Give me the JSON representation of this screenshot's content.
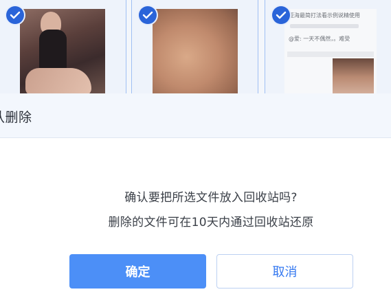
{
  "files": [
    {
      "selected": true,
      "kind": "photo"
    },
    {
      "selected": true,
      "kind": "photo"
    },
    {
      "selected": true,
      "kind": "screenshot",
      "preview_lines": [
        "亚海最简打法看示例说精使用",
        "@爱: 一天不偶然，。难受"
      ]
    }
  ],
  "dialog": {
    "title": "认删除",
    "message_line1": "确认要把所选文件放入回收站吗?",
    "message_line2": "删除的文件可在10天内通过回收站还原",
    "confirm_label": "确定",
    "cancel_label": "取消"
  },
  "colors": {
    "accent": "#4c8ff7",
    "check": "#2a64d9",
    "cancel_text": "#3478f0"
  }
}
